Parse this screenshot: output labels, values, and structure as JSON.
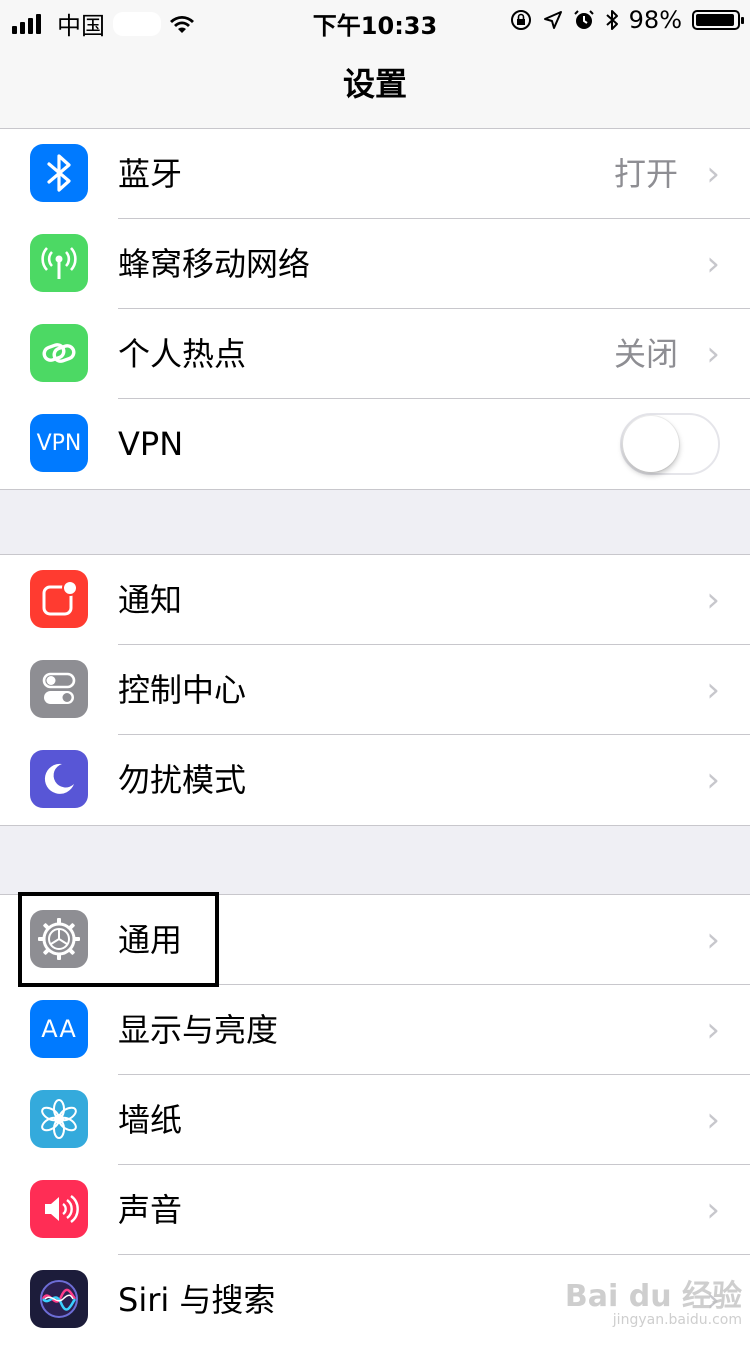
{
  "status_bar": {
    "carrier": "中国",
    "time": "下午10:33",
    "battery_percent": "98%",
    "battery_level": 0.98,
    "signal_bars": 4,
    "icons": [
      "wifi-icon",
      "orientation-lock-icon",
      "location-icon",
      "alarm-icon",
      "bluetooth-icon"
    ]
  },
  "nav": {
    "title": "设置"
  },
  "colors": {
    "blue": "#007aff",
    "green": "#4cd964",
    "red": "#ff3b30",
    "gray": "#8e8e93",
    "purple": "#5856d6",
    "teal": "#34aadc",
    "pink": "#ff2d55"
  },
  "groups": [
    {
      "rows": [
        {
          "label": "蓝牙",
          "value": "打开",
          "icon": "bluetooth-icon"
        },
        {
          "label": "蜂窝移动网络",
          "value": "",
          "icon": "antenna-icon"
        },
        {
          "label": "个人热点",
          "value": "关闭",
          "icon": "hotspot-link-icon"
        },
        {
          "label": "VPN",
          "icon_text": "VPN",
          "toggle_on": false,
          "icon": "vpn-icon"
        }
      ]
    },
    {
      "rows": [
        {
          "label": "通知",
          "icon": "notification-icon"
        },
        {
          "label": "控制中心",
          "icon": "control-center-icon"
        },
        {
          "label": "勿扰模式",
          "icon": "moon-icon"
        }
      ]
    },
    {
      "rows": [
        {
          "label": "通用",
          "icon": "gear-icon",
          "highlighted": true
        },
        {
          "label": "显示与亮度",
          "icon_text": "AA",
          "icon": "text-size-icon"
        },
        {
          "label": "墙纸",
          "icon": "flower-icon"
        },
        {
          "label": "声音",
          "icon": "speaker-icon"
        },
        {
          "label": "Siri 与搜索",
          "icon": "siri-icon"
        }
      ]
    }
  ],
  "watermark": {
    "text": "Bai du 经验",
    "sub": "jingyan.baidu.com"
  }
}
